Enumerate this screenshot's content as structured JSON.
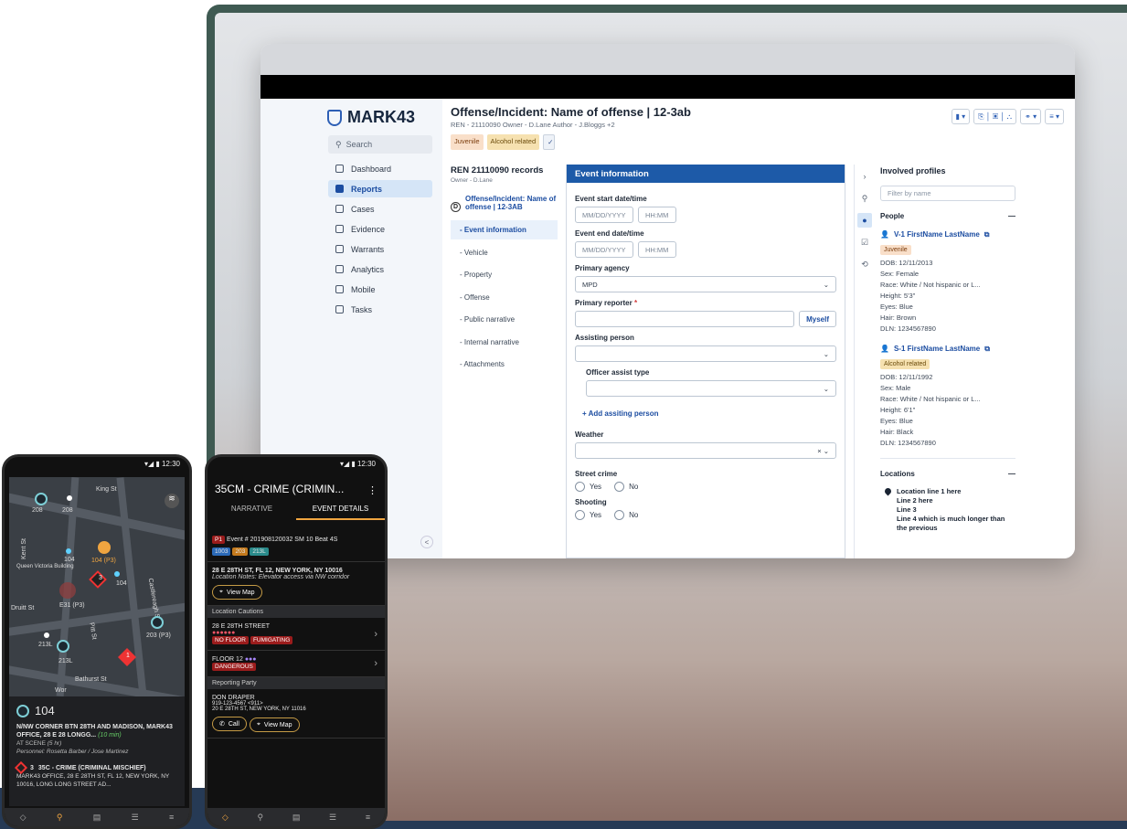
{
  "desktop": {
    "logo": "MARK43",
    "search": "Search",
    "nav": [
      {
        "label": "Dashboard",
        "icon": "home-icon"
      },
      {
        "label": "Reports",
        "icon": "report-icon",
        "active": true
      },
      {
        "label": "Cases",
        "icon": "folder-icon"
      },
      {
        "label": "Evidence",
        "icon": "evidence-icon"
      },
      {
        "label": "Warrants",
        "icon": "warrant-icon"
      },
      {
        "label": "Analytics",
        "icon": "chart-icon"
      },
      {
        "label": "Mobile",
        "icon": "mobile-icon"
      },
      {
        "label": "Tasks",
        "icon": "tasks-icon"
      }
    ],
    "collapse": "<",
    "title": "Offense/Incident: Name of offense | 12-3ab",
    "subtitle": "REN - 21110090   Owner - D.Lane   Author - J.Bloggs +2",
    "tags": [
      "Juvenile",
      "Alcohol related"
    ],
    "edit": "✓",
    "records": {
      "title": "REN 21110090 records",
      "owner": "Owner - D.Lane",
      "main_badge": "D",
      "main_label": "Offense/Incident: Name of offense | 12-3AB",
      "links": [
        "- Event information",
        "- Vehicle",
        "- Property",
        "- Offense",
        "- Public narrative",
        "- Internal narrative",
        "- Attachments"
      ]
    },
    "form": {
      "header": "Event information",
      "start_label": "Event start date/time",
      "date_ph": "MM/DD/YYYY",
      "time_ph": "HH:MM",
      "end_label": "Event end date/time",
      "agency_label": "Primary agency",
      "agency_value": "MPD",
      "reporter_label": "Primary reporter",
      "req": "*",
      "myself": "Myself",
      "assisting_label": "Assisting person",
      "officer_label": "Officer assist type",
      "add_assisting": "+ Add assiting person",
      "weather_label": "Weather",
      "clear": "×",
      "street_label": "Street crime",
      "yes": "Yes",
      "no": "No",
      "shooting_label": "Shooting"
    },
    "profiles": {
      "title": "Involved profiles",
      "filter_ph": "Filter by name",
      "people": "People",
      "collapse": "—",
      "p1": {
        "name": "V-1 FirstName LastName",
        "tag": "Juvenile",
        "fields": [
          "DOB: 12/11/2013",
          "Sex: Female",
          "Race: White / Not hispanic or L...",
          "Height: 5'3\"",
          "Eyes: Blue",
          "Hair: Brown",
          "DLN: 1234567890"
        ]
      },
      "p2": {
        "name": "S-1 FirstName LastName",
        "tag": "Alcohol related",
        "fields": [
          "DOB: 12/11/1992",
          "Sex: Male",
          "Race: White / Not hispanic or L...",
          "Height: 6'1\"",
          "Eyes: Blue",
          "Hair: Black",
          "DLN: 1234567890"
        ]
      },
      "locations": "Locations",
      "loc_lines": [
        "Location line 1 here",
        "Line 2 here",
        "Line 3",
        "Line 4 which is much longer than the previous"
      ]
    }
  },
  "phone1": {
    "time": "12:30",
    "map_labels": [
      "King St",
      "208",
      "208",
      "104",
      "104 (P3)",
      "Queen Victoria Building",
      "3",
      "104",
      "E31 (P3)",
      "Druitt St",
      "Kent St",
      "Castlereagh St",
      "Pitt St",
      "213L",
      "213L",
      "203 (P3)",
      "1",
      "Bathurst St",
      "Wor"
    ],
    "card": {
      "unit": "104",
      "addr": "N/NW CORNER BTN 28TH AND MADISON, MARK43 OFFICE, 28 E 28 LONGG...",
      "eta": "(10 min)",
      "status": "AT SCENE",
      "status_time": "(5 hr)",
      "personnel": "Personnel: Rosetta Barber / Jose Martinez",
      "call_num": "3",
      "call": "35C - CRIME (CRIMINAL MISCHIEF)",
      "call_addr": "MARK43 OFFICE, 28 E 28TH ST, FL 12, NEW YORK, NY 10016, LONG LONG STREET AD..."
    }
  },
  "phone2": {
    "time": "12:30",
    "title": "35CM - CRIME (CRIMIN...",
    "tabs": [
      "NARRATIVE",
      "EVENT DETAILS"
    ],
    "priority": "P1",
    "event": "Event # 201908120032   SM 10   Beat 4S",
    "units": [
      "1003",
      "203",
      "213L"
    ],
    "address": "28 E 28TH ST, FL 12, NEW YORK, NY 10016",
    "notes": "Location Notes:  Elevator access via NW corridor",
    "view_map": "View Map",
    "cautions_title": "Location Cautions",
    "caution1": {
      "place": "28 E 28TH STREET",
      "tags": [
        "NO FLOOR",
        "FUMIGATING"
      ]
    },
    "caution2": {
      "place": "FLOOR 12",
      "tags": [
        "DANGEROUS"
      ]
    },
    "reporting": "Reporting Party",
    "party": {
      "name": "DON DRAPER",
      "phone": "919-123-4567 <911>",
      "addr": "20 E 28TH ST, NEW YORK, NY 11016"
    },
    "call": "Call"
  },
  "colors": {
    "brand": "#1d5aa8",
    "accent": "#f0a540",
    "danger": "#9b1c1c"
  }
}
